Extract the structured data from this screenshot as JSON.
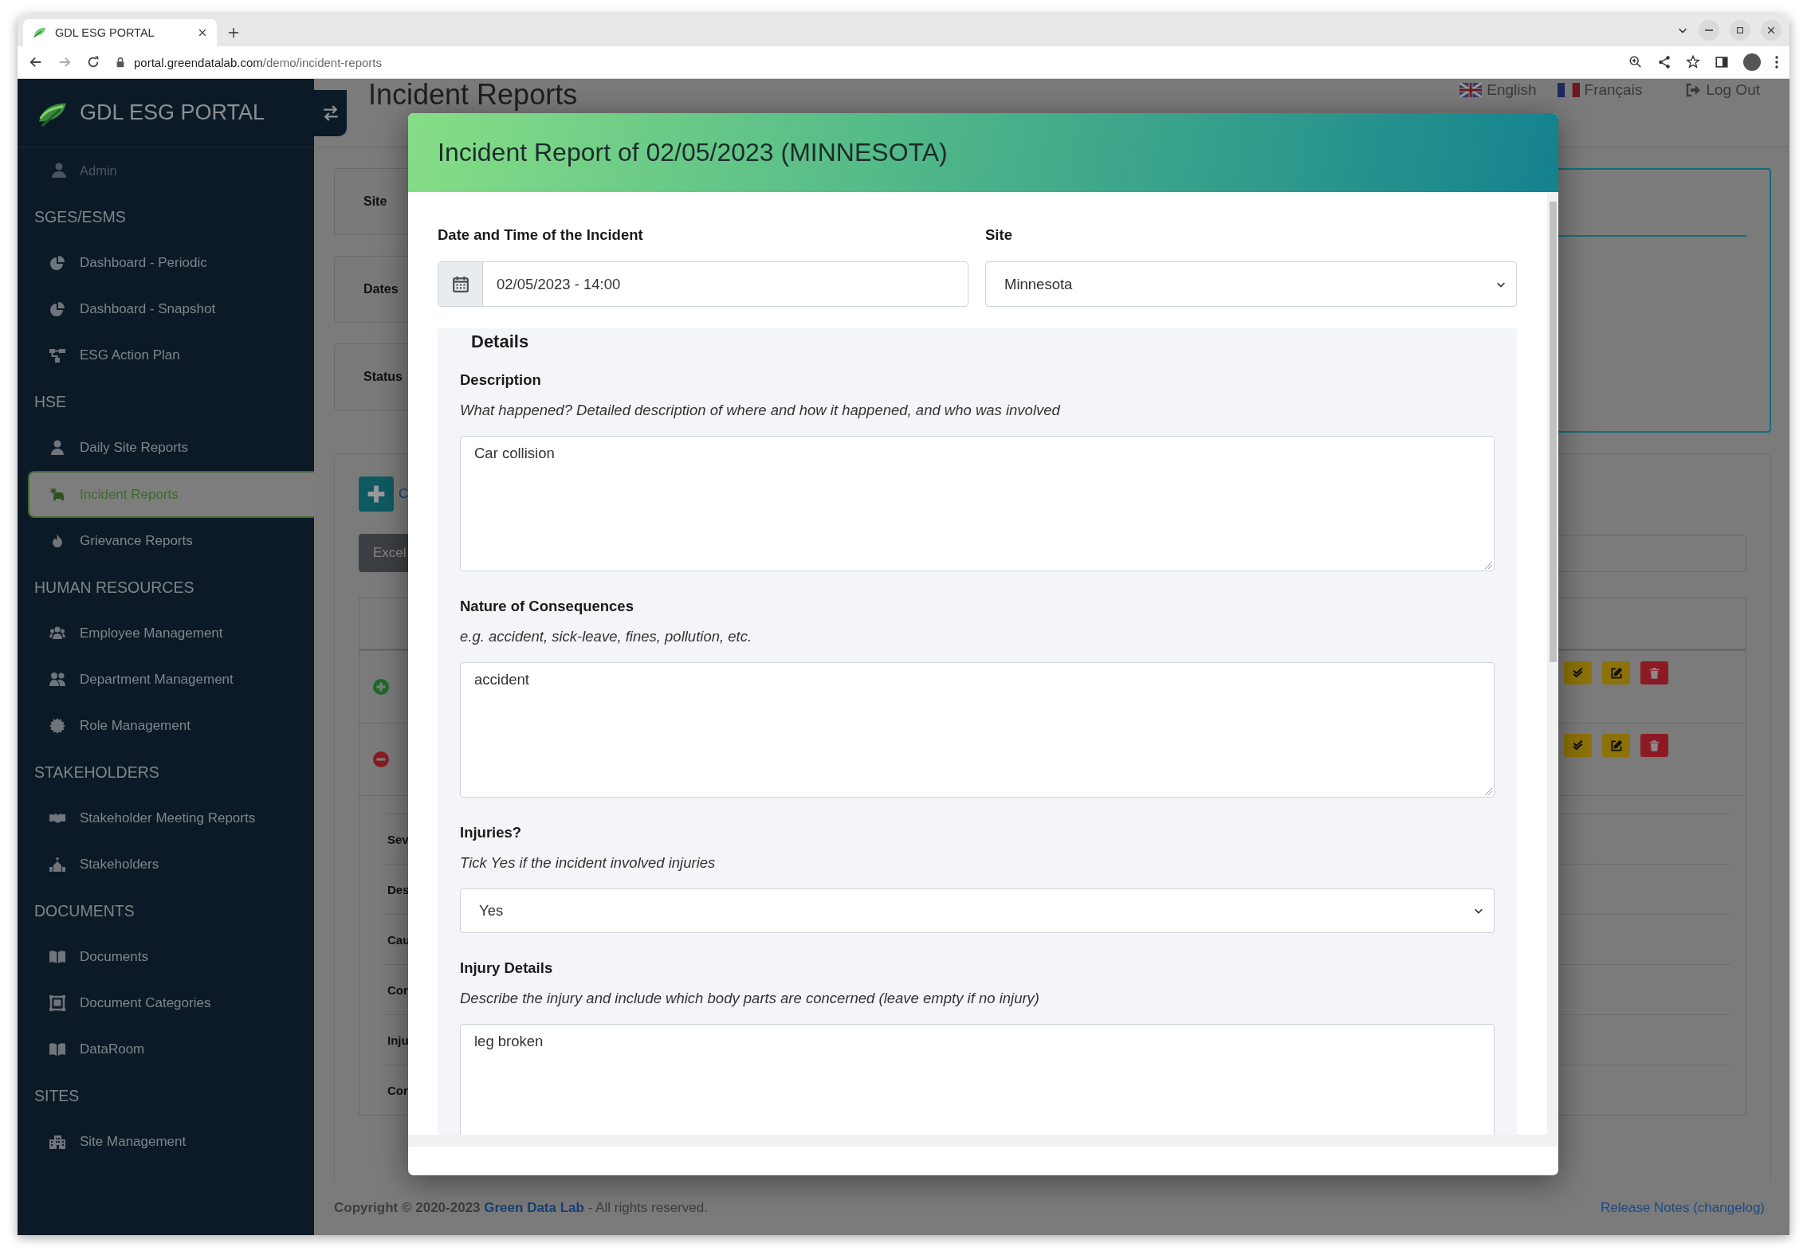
{
  "browser": {
    "tab_title": "GDL ESG PORTAL",
    "url_host": "portal.greendatalab.com",
    "url_path": "/demo/incident-reports"
  },
  "sidebar": {
    "brand": "GDL ESG PORTAL",
    "user": "Admin",
    "sections": [
      {
        "title": "SGES/ESMS",
        "items": [
          {
            "label": "Dashboard - Periodic",
            "selected": false
          },
          {
            "label": "Dashboard - Snapshot",
            "selected": false
          },
          {
            "label": "ESG Action Plan",
            "selected": false
          }
        ]
      },
      {
        "title": "HSE",
        "items": [
          {
            "label": "Daily Site Reports",
            "selected": false
          },
          {
            "label": "Incident Reports",
            "selected": true
          },
          {
            "label": "Grievance Reports",
            "selected": false
          }
        ]
      },
      {
        "title": "HUMAN RESOURCES",
        "items": [
          {
            "label": "Employee Management",
            "selected": false
          },
          {
            "label": "Department Management",
            "selected": false
          },
          {
            "label": "Role Management",
            "selected": false
          }
        ]
      },
      {
        "title": "STAKEHOLDERS",
        "items": [
          {
            "label": "Stakeholder Meeting Reports",
            "selected": false
          },
          {
            "label": "Stakeholders",
            "selected": false
          }
        ]
      },
      {
        "title": "DOCUMENTS",
        "items": [
          {
            "label": "Documents",
            "selected": false
          },
          {
            "label": "Document Categories",
            "selected": false
          },
          {
            "label": "DataRoom",
            "selected": false
          }
        ]
      },
      {
        "title": "SITES",
        "items": [
          {
            "label": "Site Management",
            "selected": false
          }
        ]
      }
    ]
  },
  "header": {
    "title": "Incident Reports",
    "languages": [
      "English",
      "Français"
    ],
    "logout": "Log Out"
  },
  "filters": [
    "Site",
    "Dates",
    "Status"
  ],
  "actions": {
    "add_label": "C",
    "excel": "Excel"
  },
  "table": {
    "rows": [
      {
        "expanded": false
      },
      {
        "expanded": true,
        "details": [
          "Sev",
          "Des",
          "Cau",
          "Cor",
          "Inju",
          "Cor"
        ]
      }
    ]
  },
  "footer": {
    "copyright": "**Copyright © 2020-2023**",
    "company": "Green Data Lab",
    "rights": "- All rights reserved.",
    "release_notes": "Release Notes (changelog)"
  },
  "modal": {
    "title": "Incident Report of 02/05/2023 (MINNESOTA)",
    "date_label": "Date and Time of the Incident",
    "date_value": "02/05/2023 - 14:00",
    "site_label": "Site",
    "site_value": "Minnesota",
    "details_legend": "Details",
    "fields": [
      {
        "kind": "textarea",
        "label": "Description",
        "help": "What happened? Detailed description of where and how it happened, and who was involved",
        "value": "Car collision"
      },
      {
        "kind": "textarea",
        "label": "Nature of Consequences",
        "help": "e.g. accident, sick-leave, fines, pollution, etc.",
        "value": "accident"
      },
      {
        "kind": "select",
        "label": "Injuries?",
        "help": "Tick Yes if the incident involved injuries",
        "value": "Yes"
      },
      {
        "kind": "textarea",
        "label": "Injury Details",
        "help": "Describe the injury and include which body parts are concerned (leave empty if no injury)",
        "value": "leg broken"
      }
    ]
  }
}
